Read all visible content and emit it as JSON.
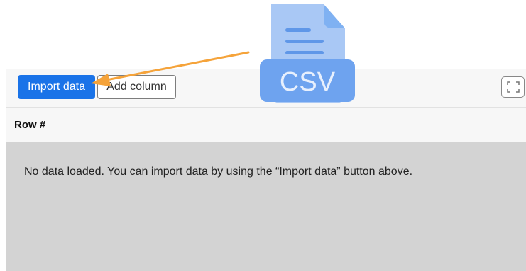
{
  "toolbar": {
    "import_label": "Import data",
    "add_column_label": "Add column"
  },
  "table": {
    "header": "Row #"
  },
  "empty_state": {
    "message": "No data loaded. You can import data by using the “Import data” button above."
  },
  "overlay": {
    "file_type_label": "CSV"
  },
  "colors": {
    "primary": "#1a73e8",
    "arrow": "#f5a33a",
    "csv_file": "#a9c8f5",
    "csv_band": "#6ea3ef",
    "empty_bg": "#d3d3d3"
  },
  "icons": [
    "expand-icon",
    "csv-file-icon",
    "arrow-annotation"
  ]
}
